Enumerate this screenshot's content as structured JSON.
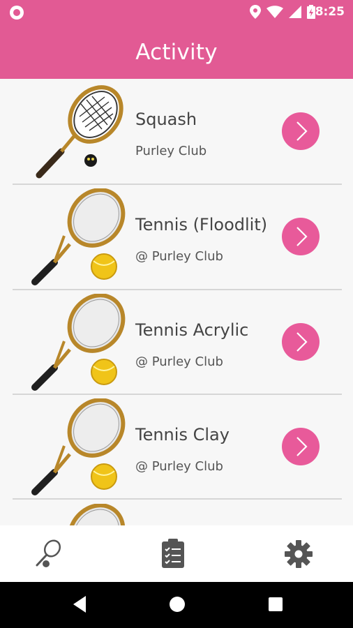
{
  "status": {
    "time": "8:25"
  },
  "appbar": {
    "title": "Activity"
  },
  "activities": [
    {
      "title": "Squash",
      "subtitle": "Purley Club",
      "icon": "squash-racket-icon"
    },
    {
      "title": "Tennis (Floodlit)",
      "subtitle": "@ Purley Club",
      "icon": "tennis-racket-icon"
    },
    {
      "title": "Tennis Acrylic",
      "subtitle": "@ Purley Club",
      "icon": "tennis-racket-icon"
    },
    {
      "title": "Tennis Clay",
      "subtitle": "@ Purley Club",
      "icon": "tennis-racket-icon"
    }
  ],
  "bottom_nav": [
    {
      "name": "activity-tab",
      "icon": "racket-ball-icon"
    },
    {
      "name": "bookings-tab",
      "icon": "clipboard-checklist-icon"
    },
    {
      "name": "settings-tab",
      "icon": "gear-icon"
    }
  ],
  "colors": {
    "accent": "#e25a94",
    "button": "#e85a9a"
  }
}
